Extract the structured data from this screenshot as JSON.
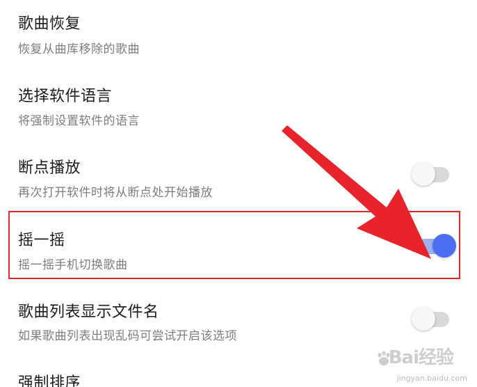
{
  "settings": [
    {
      "title": "歌曲恢复",
      "subtitle": "恢复从曲库移除的歌曲",
      "has_toggle": false
    },
    {
      "title": "选择软件语言",
      "subtitle": "将强制设置软件的语言",
      "has_toggle": false
    },
    {
      "title": "断点播放",
      "subtitle": "再次打开软件时将从断点处开始播放",
      "has_toggle": true,
      "toggle_on": false
    },
    {
      "title": "摇一摇",
      "subtitle": "摇一摇手机切换歌曲",
      "has_toggle": true,
      "toggle_on": true
    },
    {
      "title": "歌曲列表显示文件名",
      "subtitle": "如果歌曲列表出现乱码可尝试开启该选项",
      "has_toggle": true,
      "toggle_on": false
    },
    {
      "title": "强制排序",
      "subtitle": "",
      "has_toggle": false
    }
  ],
  "colors": {
    "accent": "#4c6ef2",
    "annotation_red": "#e8232c"
  },
  "watermark": {
    "logo_text": "Bai经验",
    "url_text": "jingyan.baidu.com"
  }
}
